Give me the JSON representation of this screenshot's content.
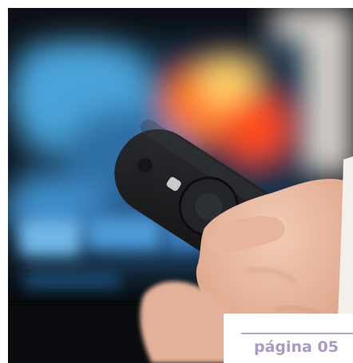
{
  "photo": {
    "subject": "hand-holding-remote-in-front-of-tv",
    "colors": {
      "tv_blue": "#2f6fa6",
      "tv_glow": "#ff7a2a",
      "background": "#0d1117",
      "remote": "#1f2123",
      "skin": "#e7b8a0"
    }
  },
  "footer": {
    "page_label": "página 05",
    "accent_color": "#a99bc3"
  }
}
